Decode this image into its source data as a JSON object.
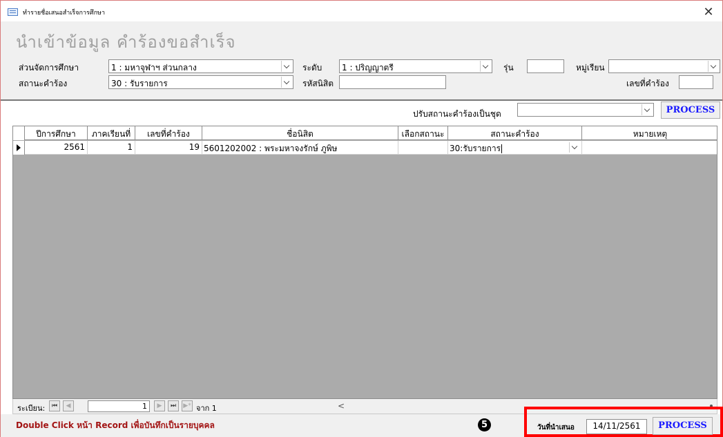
{
  "window": {
    "title": "ทำรายชื่อเสนอสำเร็จการศึกษา",
    "close_glyph": "✕"
  },
  "header": {
    "big_title": "นำเข้าข้อมูล คำร้องขอสำเร็จ"
  },
  "filters": {
    "division_label": "ส่วนจัดการศึกษา",
    "division_value": "1 : มหาจุฬาฯ  ส่วนกลาง",
    "level_label": "ระดับ",
    "level_value": "1 : ปริญญาตรี",
    "batch_label": "รุ่น",
    "batch_value": "",
    "group_label": "หมู่เรียน",
    "group_value": "",
    "status_label": "สถานะคำร้อง",
    "status_value": "30 : รับรายการ",
    "student_id_label": "รหัสนิสิต",
    "student_id_value": "",
    "petition_no_label": "เลขที่คำร้อง",
    "petition_no_value": ""
  },
  "batch_update": {
    "label": "ปรับสถานะคำร้องเป็นชุด",
    "value": "",
    "process_label": "PROCESS"
  },
  "grid": {
    "columns": [
      "ปีการศึกษา",
      "ภาคเรียนที่",
      "เลขที่คำร้อง",
      "ชื่อนิสิต",
      "เลือกสถานะ",
      "สถานะคำร้อง",
      "หมายเหตุ"
    ],
    "rows": [
      {
        "year": "2561",
        "semester": "1",
        "petition_no": "19",
        "student": "5601202002 : พระมหาจงรักษ์ ภูพิษ",
        "select_status": "",
        "status": "30:รับรายการ",
        "note": ""
      }
    ]
  },
  "navigation": {
    "record_label": "ระเบียน:",
    "first": "⏮",
    "prev": "◀",
    "current": "1",
    "next": "▶",
    "last": "⏭",
    "new": "▶*",
    "of_text": "จาก 1",
    "hscroll_left": "<"
  },
  "footer": {
    "note": "Double Click หน้า Record เพื่อบันทึกเป็นรายบุคคล",
    "step_badge": "5",
    "date_label": "วันที่นำเสนอ",
    "date_value": "14/11/2561",
    "process_label": "PROCESS"
  },
  "colors": {
    "accent_blue": "#1a1aff",
    "note_red": "#a31515",
    "highlight": "#ff0000",
    "grid_bg": "#ababab"
  }
}
